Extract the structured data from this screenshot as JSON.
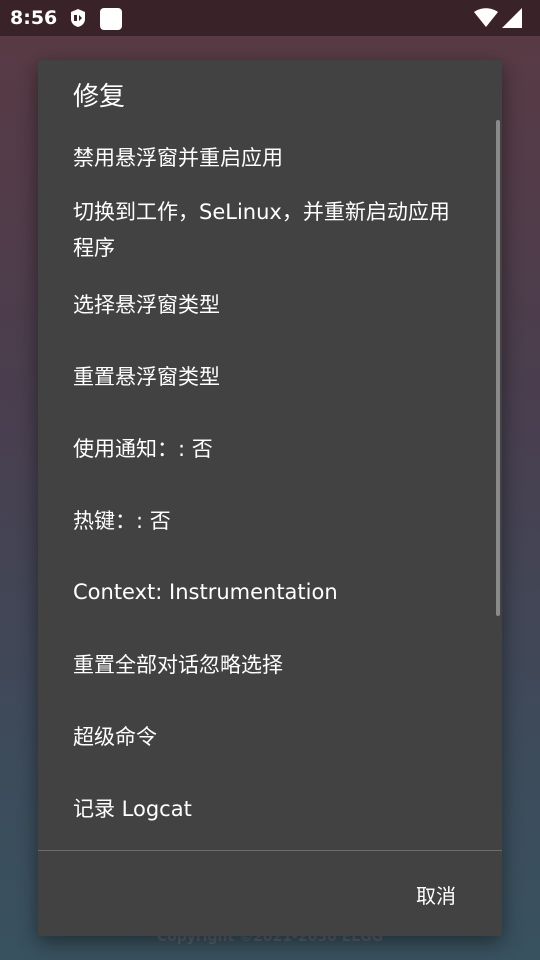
{
  "status_bar": {
    "time": "8:56",
    "icons": [
      "app-badge-icon",
      "square-notification-icon",
      "wifi-icon",
      "cellular-signal-icon"
    ]
  },
  "background": {
    "copyright": "Copyright ©2021-2030 ELGG"
  },
  "dialog": {
    "title": "修复",
    "items": [
      {
        "label": "禁用悬浮窗并重启应用"
      },
      {
        "label": "切换到工作，SeLinux，并重新启动应用程序"
      },
      {
        "label": "选择悬浮窗类型"
      },
      {
        "label": "重置悬浮窗类型"
      },
      {
        "label": "使用通知：: 否"
      },
      {
        "label": "热键：: 否"
      },
      {
        "label": "Context: Instrumentation"
      },
      {
        "label": "重置全部对话忽略选择"
      },
      {
        "label": "超级命令"
      },
      {
        "label": "记录 Logcat"
      }
    ],
    "cancel_label": "取消"
  }
}
